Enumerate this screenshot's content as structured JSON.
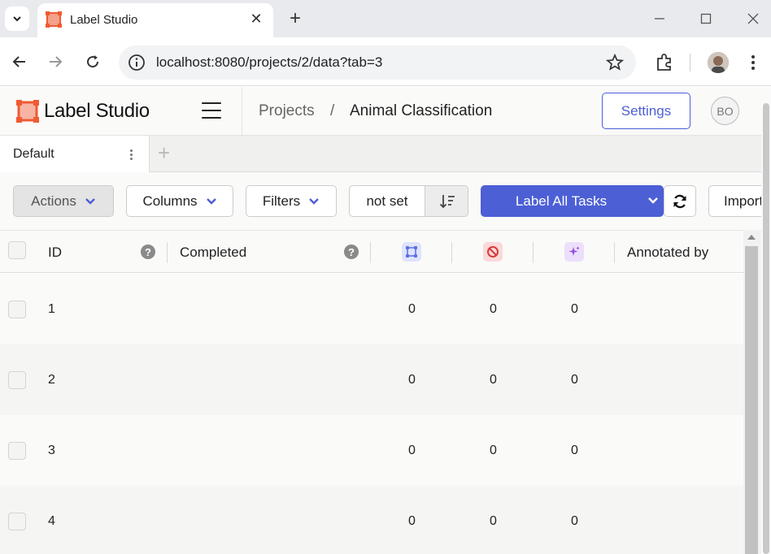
{
  "browser": {
    "tab_title": "Label Studio",
    "url": "localhost:8080/projects/2/data?tab=3"
  },
  "app": {
    "brand": "Label Studio",
    "breadcrumb": {
      "root": "Projects",
      "separator": "/",
      "current": "Animal Classification"
    },
    "settings_label": "Settings",
    "avatar_initials": "BO",
    "accent_color": "#4c5fd5"
  },
  "view_tabs": {
    "active": "Default"
  },
  "toolbar": {
    "actions_label": "Actions",
    "columns_label": "Columns",
    "filters_label": "Filters",
    "sort_label": "not set",
    "label_all_label": "Label All Tasks",
    "import_label": "Import"
  },
  "table": {
    "headers": {
      "id": "ID",
      "completed": "Completed",
      "annotated_by": "Annotated by"
    },
    "icon_columns": [
      "annotations-count-icon",
      "cancelled-count-icon",
      "predictions-count-icon"
    ],
    "rows": [
      {
        "id": "1",
        "completed": "",
        "annotations": "0",
        "cancelled": "0",
        "predictions": "0",
        "annotated_by": ""
      },
      {
        "id": "2",
        "completed": "",
        "annotations": "0",
        "cancelled": "0",
        "predictions": "0",
        "annotated_by": ""
      },
      {
        "id": "3",
        "completed": "",
        "annotations": "0",
        "cancelled": "0",
        "predictions": "0",
        "annotated_by": ""
      },
      {
        "id": "4",
        "completed": "",
        "annotations": "0",
        "cancelled": "0",
        "predictions": "0",
        "annotated_by": ""
      }
    ]
  }
}
